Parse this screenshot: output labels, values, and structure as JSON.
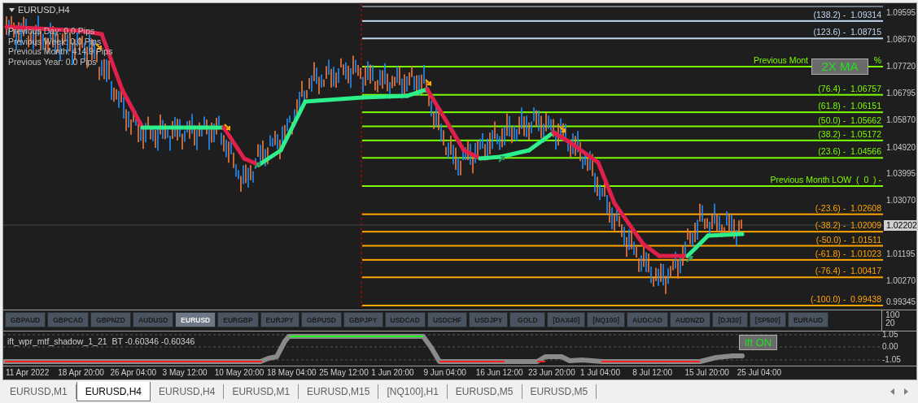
{
  "chart": {
    "title": "EURUSD,H4",
    "info": [
      "Previous Day: 0.0 Pips",
      "Previous Week: 0.0 Pips",
      "Previous Month: 414.9 Pips",
      "Previous Year: 0.0 Pips"
    ],
    "levels": [
      {
        "kind": "fib",
        "label": "(138.2) -  1.09314",
        "color": "#c0d8f0"
      },
      {
        "kind": "fib",
        "label": "(123.6) -  1.08715",
        "color": "#c0d8f0"
      },
      {
        "kind": "month_high",
        "label": "Previous Mont",
        "tail": "%",
        "color": "#7cfc00"
      },
      {
        "kind": "fib",
        "label": "(76.4) -  1.06757",
        "color": "#7cfc00"
      },
      {
        "kind": "fib",
        "label": "(61.8) -  1.06151",
        "color": "#7cfc00"
      },
      {
        "kind": "fib",
        "label": "(50.0) -  1.05662",
        "color": "#7cfc00"
      },
      {
        "kind": "fib",
        "label": "(38.2) -  1.05172",
        "color": "#7cfc00"
      },
      {
        "kind": "fib",
        "label": "(23.6) -  1.04566",
        "color": "#7cfc00"
      },
      {
        "kind": "month_low",
        "label": "Previous Month LOW  (  0  ) -",
        "color": "#7cfc00"
      },
      {
        "kind": "fib",
        "label": "(-23.6) -  1.02608",
        "color": "#ffa500"
      },
      {
        "kind": "fib",
        "label": "(-38.2) -  1.02009",
        "color": "#ffa500"
      },
      {
        "kind": "fib",
        "label": "(-50.0) -  1.01511",
        "color": "#ffa500"
      },
      {
        "kind": "fib",
        "label": "(-61.8) -  1.01023",
        "color": "#ffa500"
      },
      {
        "kind": "fib",
        "label": "(-76.4) -  1.00417",
        "color": "#ffa500"
      },
      {
        "kind": "fib",
        "label": "(-100.0) -  0.99438",
        "color": "#ffa500"
      }
    ],
    "ma_button": "2X MA",
    "price_axis": [
      "1.09595",
      "1.08670",
      "1.07720",
      "1.06795",
      "1.05870",
      "1.04920",
      "1.03995",
      "1.03070",
      "1.01195",
      "1.00270",
      "0.99345"
    ],
    "current_price": "1.02202"
  },
  "symbols": [
    {
      "label": "GBPAUD",
      "selected": false
    },
    {
      "label": "GBPCAD",
      "selected": false
    },
    {
      "label": "GBPNZD",
      "selected": false
    },
    {
      "label": "AUDUSD",
      "selected": false
    },
    {
      "label": "EURUSD",
      "selected": true
    },
    {
      "label": "EURGBP",
      "selected": false
    },
    {
      "label": "EURJPY",
      "selected": false
    },
    {
      "label": "GBPUSD",
      "selected": false
    },
    {
      "label": "GBPJPY",
      "selected": false
    },
    {
      "label": "USDCAD",
      "selected": false
    },
    {
      "label": "USDCHF",
      "selected": false
    },
    {
      "label": "USDJPY",
      "selected": false
    },
    {
      "label": "GOLD",
      "selected": false
    },
    {
      "label": "[DAX40]",
      "selected": false
    },
    {
      "label": "[NQ100]",
      "selected": false
    },
    {
      "label": "AUDCAD",
      "selected": false
    },
    {
      "label": "AUDNZD",
      "selected": false
    },
    {
      "label": "[DJI30]",
      "selected": false
    },
    {
      "label": "[SP500]",
      "selected": false
    },
    {
      "label": "EURAUD",
      "selected": false
    }
  ],
  "symbol_axis": [
    "100",
    "20"
  ],
  "indicator": {
    "title": "ift_wpr_mtf_shadow_1_21  BT -0.60346 -0.60346",
    "button": "ift ON",
    "axis": [
      "1.05",
      "0.00",
      "-1.05"
    ]
  },
  "time_axis": [
    "11 Apr 2022",
    "18 Apr 20:00",
    "26 Apr 04:00",
    "3 May 12:00",
    "10 May 20:00",
    "18 May 04:00",
    "25 May 12:00",
    "1 Jun 20:00",
    "9 Jun 04:00",
    "16 Jun 12:00",
    "23 Jun 20:00",
    "1 Jul 04:00",
    "8 Jul 12:00",
    "15 Jul 20:00",
    "25 Jul 04:00"
  ],
  "tabs": [
    {
      "label": "EURUSD,M1",
      "selected": false
    },
    {
      "label": "EURUSD,H4",
      "selected": true
    },
    {
      "label": "EURUSD,H4",
      "selected": false
    },
    {
      "label": "EURUSD,M1",
      "selected": false
    },
    {
      "label": "EURUSD,M15",
      "selected": false
    },
    {
      "label": "[NQ100],H1",
      "selected": false
    },
    {
      "label": "EURUSD,M5",
      "selected": false
    },
    {
      "label": "EURUSD,M5",
      "selected": false
    }
  ]
}
